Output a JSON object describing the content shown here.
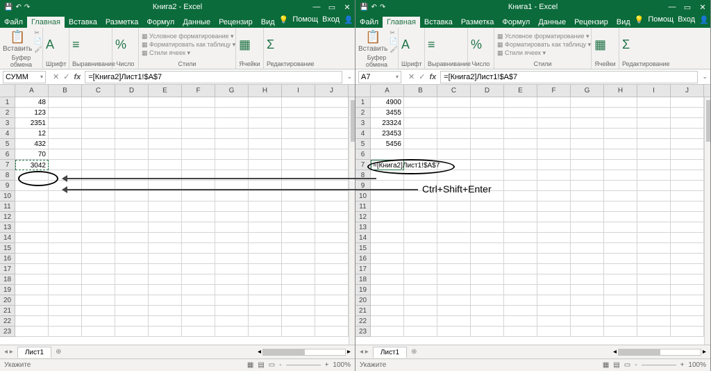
{
  "windows": [
    {
      "title": "Книга2 - Excel",
      "tabs": [
        "Файл",
        "Главная",
        "Вставка",
        "Разметка",
        "Формул",
        "Данные",
        "Рецензир",
        "Вид"
      ],
      "active_tab": "Главная",
      "help_label": "Помощ",
      "signin_label": "Вход",
      "share_label": "Общий доступ",
      "ribbon": {
        "clipboard": {
          "paste": "Вставить",
          "label": "Буфер обмена"
        },
        "font": {
          "label": "Шрифт"
        },
        "align": {
          "label": "Выравнивание"
        },
        "number": {
          "label": "Число"
        },
        "styles": {
          "cond": "Условное форматирование",
          "table": "Форматировать как таблицу",
          "cell": "Стили ячеек",
          "label": "Стили"
        },
        "cells": {
          "label": "Ячейки"
        },
        "editing": {
          "label": "Редактирование"
        }
      },
      "namebox": "СУММ",
      "formula": "=[Книга2]Лист1!$A$7",
      "columns": [
        "A",
        "B",
        "C",
        "D",
        "E",
        "F",
        "G",
        "H",
        "I",
        "J"
      ],
      "rows": 23,
      "data": {
        "1": "48",
        "2": "123",
        "3": "2351",
        "4": "12",
        "5": "432",
        "6": "70",
        "7": "3042"
      },
      "marching_cell": "A7",
      "sheet": "Лист1",
      "status": "Укажите",
      "zoom": "100%"
    },
    {
      "title": "Книга1 - Excel",
      "tabs": [
        "Файл",
        "Главная",
        "Вставка",
        "Разметка",
        "Формул",
        "Данные",
        "Рецензир",
        "Вид"
      ],
      "active_tab": "Главная",
      "help_label": "Помощ",
      "signin_label": "Вход",
      "share_label": "Общий доступ",
      "ribbon": {
        "clipboard": {
          "paste": "Вставить",
          "label": "Буфер обмена"
        },
        "font": {
          "label": "Шрифт"
        },
        "align": {
          "label": "Выравнивание"
        },
        "number": {
          "label": "Число"
        },
        "styles": {
          "cond": "Условное форматирование",
          "table": "Форматировать как таблицу",
          "cell": "Стили ячеек",
          "label": "Стили"
        },
        "cells": {
          "label": "Ячейки"
        },
        "editing": {
          "label": "Редактирование"
        }
      },
      "namebox": "A7",
      "formula": "=[Книга2]Лист1!$A$7",
      "columns": [
        "A",
        "B",
        "C",
        "D",
        "E",
        "F",
        "G",
        "H",
        "I",
        "J"
      ],
      "rows": 23,
      "data": {
        "1": "4900",
        "2": "3455",
        "3": "23324",
        "4": "23453",
        "5": "5456",
        "6": "",
        "7": "=[Книга2]Лист1!$A$7"
      },
      "editing_cell": "A7",
      "sheet": "Лист1",
      "status": "Укажите",
      "zoom": "100%"
    }
  ],
  "annotation": {
    "text": "Ctrl+Shift+Enter"
  }
}
